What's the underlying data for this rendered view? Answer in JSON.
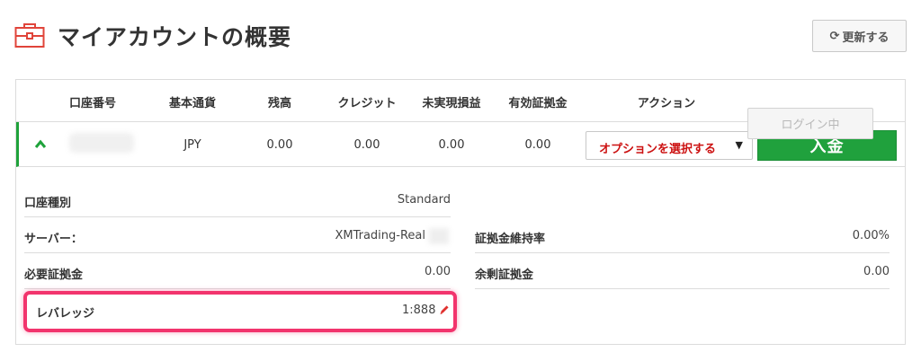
{
  "header": {
    "title": "マイアカウントの概要",
    "refresh_label": "更新する",
    "refresh_icon": "refresh-icon",
    "title_icon": "briefcase-icon",
    "accent_color": "#e0443a"
  },
  "table": {
    "columns": [
      "口座番号",
      "基本通貨",
      "残高",
      "クレジット",
      "未実現損益",
      "有効証拠金",
      "アクション"
    ],
    "row": {
      "currency": "JPY",
      "balance": "0.00",
      "credit": "0.00",
      "unrealized_pnl": "0.00",
      "equity": "0.00",
      "options_label": "オプションを選択する",
      "deposit_label": "入金"
    }
  },
  "details": {
    "account_type_label": "口座種別",
    "account_type_value": "Standard",
    "server_label": "サーバー：",
    "server_value": "XMTrading-Real",
    "required_margin_label": "必要証拠金",
    "required_margin_value": "0.00",
    "leverage_label": "レバレッジ",
    "leverage_value": "1:888",
    "margin_level_label": "証拠金維持率",
    "margin_level_value": "0.00%",
    "free_margin_label": "余剰証拠金",
    "free_margin_value": "0.00",
    "login_label": "ログイン中"
  },
  "colors": {
    "deposit": "#20a13d",
    "options_text": "#cc1111",
    "highlight": "#f2346d",
    "pencil": "#e0302e"
  }
}
